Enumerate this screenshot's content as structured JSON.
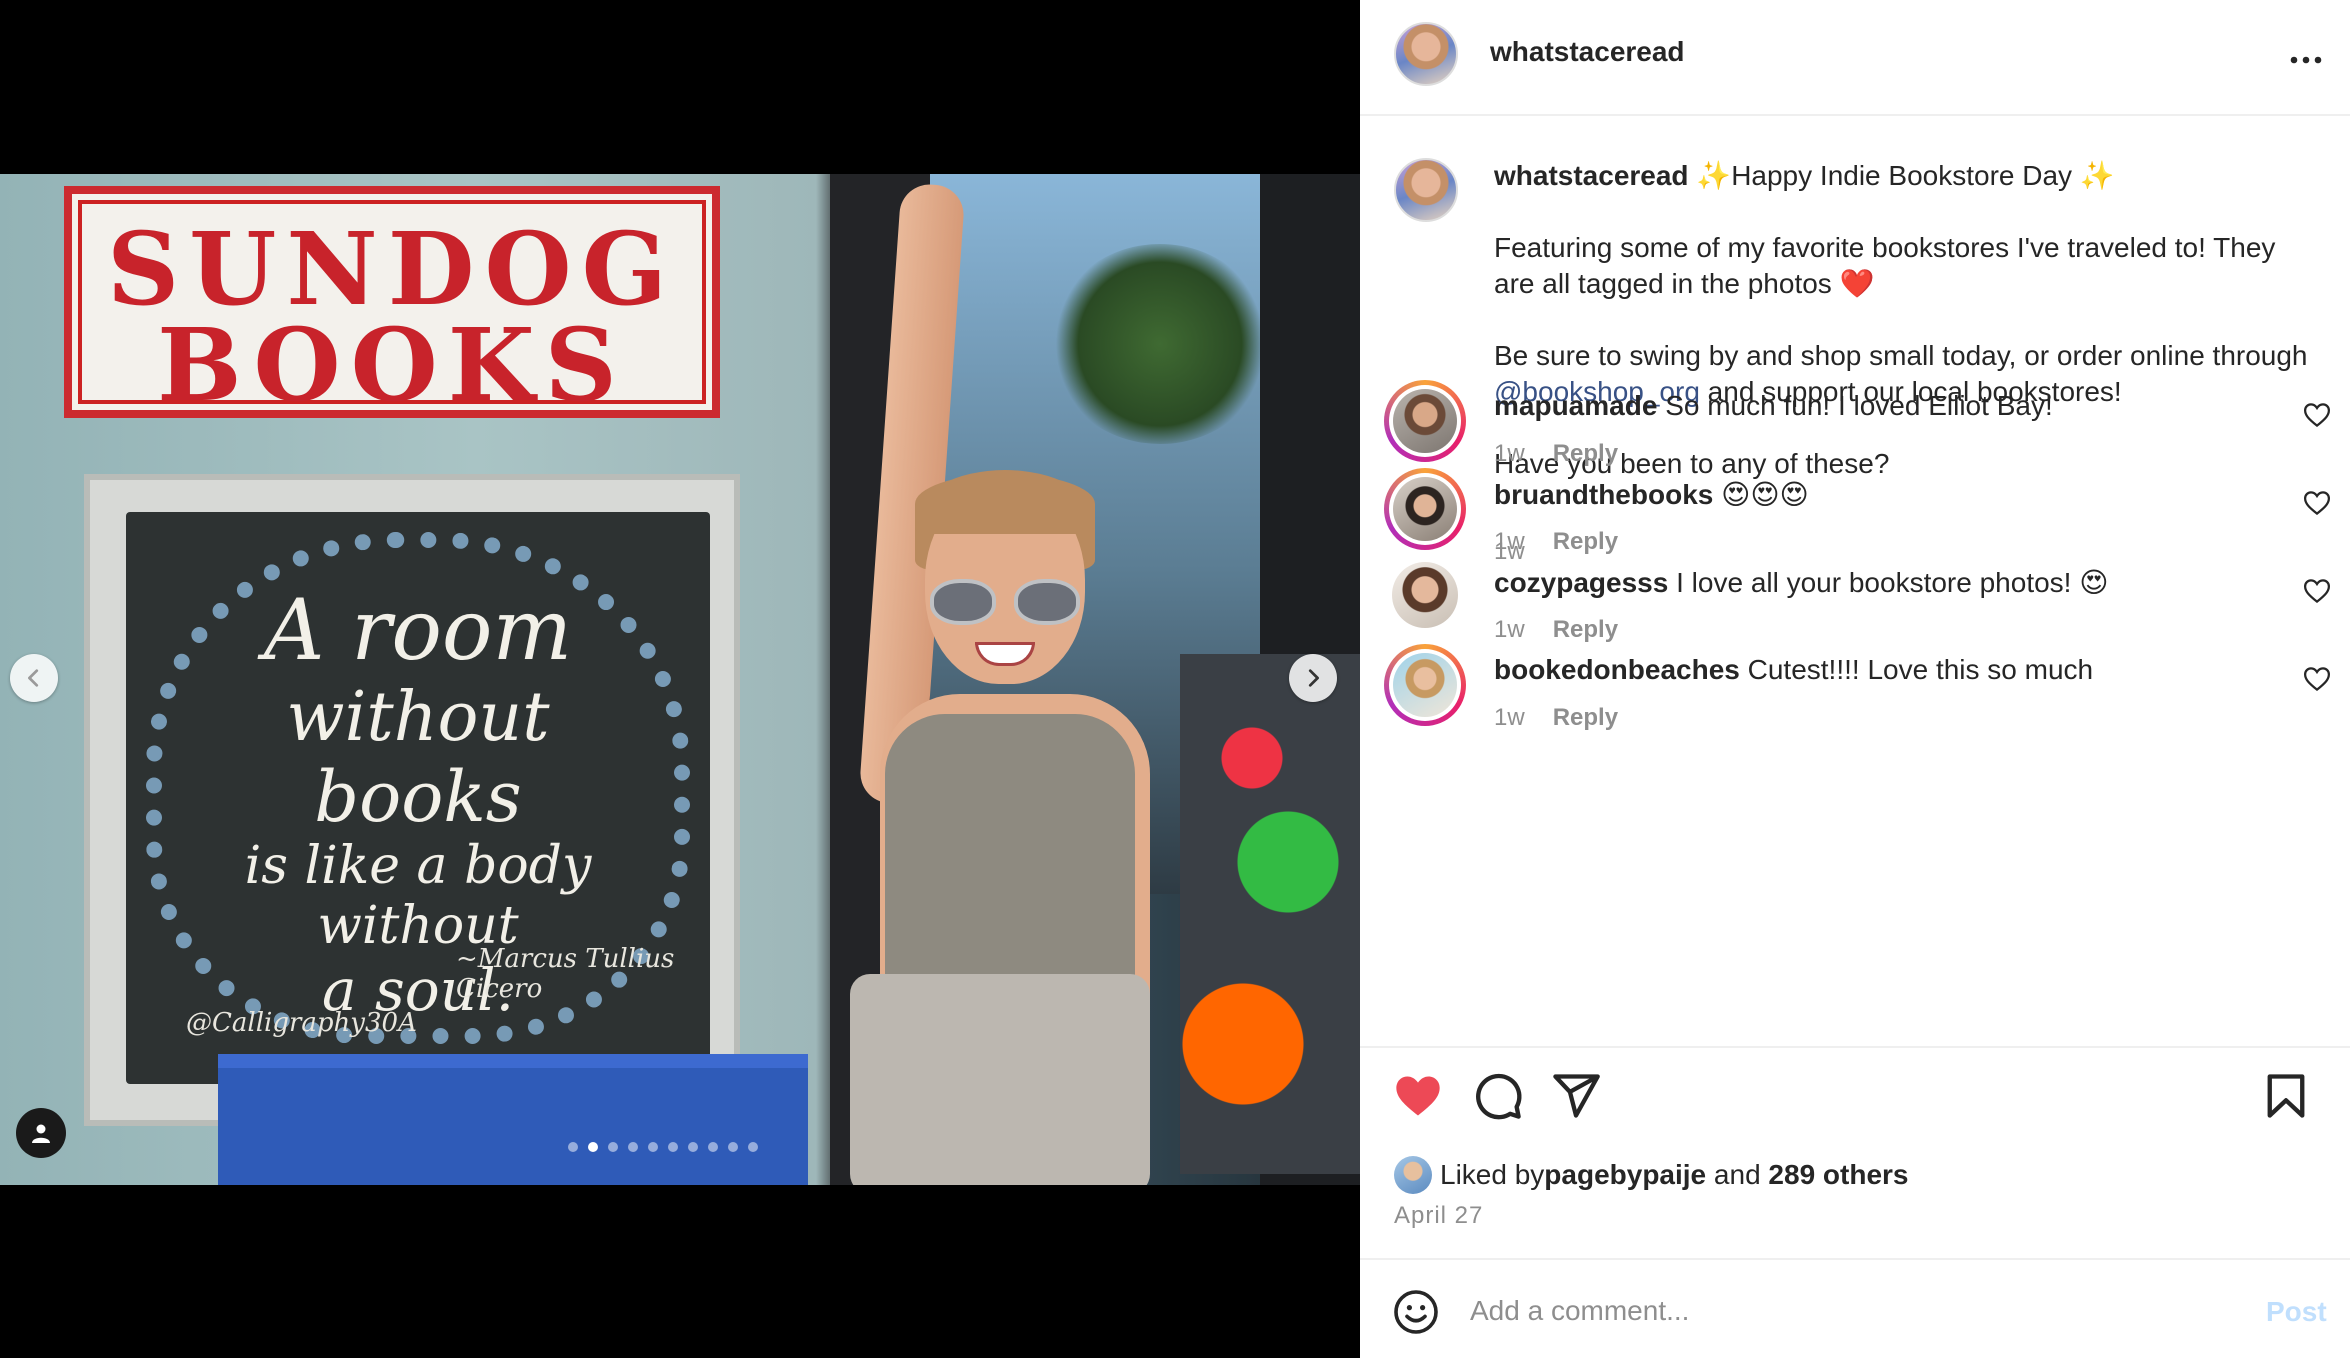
{
  "post": {
    "username": "whatstaceread",
    "more_icon": "more-horizontal-icon"
  },
  "photo": {
    "sign_line1": "SUNDOG",
    "sign_line2": "BOOKS",
    "quote_line1": "A room",
    "quote_line2": "without",
    "quote_line3": "books",
    "quote_line4": "is like a body without",
    "quote_line5": "a soul.",
    "quote_author": "~Marcus Tullius Cicero",
    "signature": "@Calligraphy30A",
    "prev_icon": "chevron-left-icon",
    "next_icon": "chevron-right-icon",
    "tag_icon": "user-tag-icon",
    "slide_index": 1,
    "slide_count": 10
  },
  "caption": {
    "username": "whatstaceread",
    "line1": "✨Happy Indie Bookstore Day ✨",
    "para1": "Featuring some of my favorite bookstores I've traveled to! They are all tagged in the photos ❤️",
    "para2_a": "Be sure to swing by and shop small today, or order online through ",
    "para2_link": "@bookshop_org",
    "para2_b": " and support our local bookstores!",
    "para3": "Have you been to any of these?",
    "time": "1w"
  },
  "comments": [
    {
      "username": "mapuamade",
      "text": "So much fun! I loved Elliot Bay!",
      "time": "1w",
      "reply": "Reply"
    },
    {
      "username": "bruandthebooks",
      "text": "😍😍😍",
      "time": "1w",
      "reply": "Reply"
    },
    {
      "username": "cozypagesss",
      "text": "I love all your bookstore photos! 😍",
      "time": "1w",
      "reply": "Reply"
    },
    {
      "username": "bookedonbeaches",
      "text": "Cutest!!!! Love this so much",
      "time": "1w",
      "reply": "Reply"
    }
  ],
  "actions": {
    "like_icon": "heart-filled-icon",
    "comment_icon": "comment-icon",
    "share_icon": "share-icon",
    "save_icon": "bookmark-icon",
    "liked_by_prefix": "Liked by ",
    "liked_by_user": "pagebypaije",
    "liked_by_and": " and ",
    "liked_by_others": "289 others",
    "date": "April 27"
  },
  "comment_box": {
    "placeholder": "Add a comment...",
    "post_label": "Post",
    "emoji_icon": "emoji-icon"
  },
  "colors": {
    "like_red": "#ed4956",
    "link_blue": "#385185",
    "post_disabled": "#c0dffd"
  }
}
